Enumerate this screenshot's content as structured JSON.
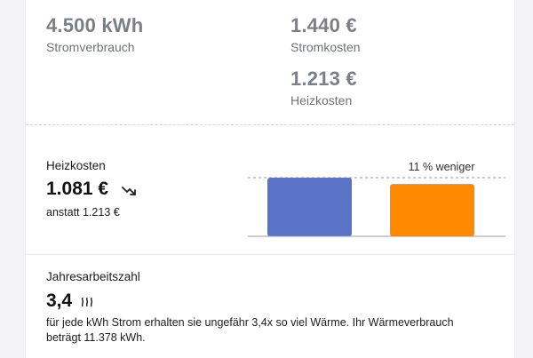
{
  "summary": {
    "power_usage_value": "4.500 kWh",
    "power_usage_label": "Stromverbrauch",
    "power_cost_value": "1.440 €",
    "power_cost_label": "Stromkosten",
    "heating_cost_value": "1.213 €",
    "heating_cost_label": "Heizkosten"
  },
  "heating": {
    "title": "Heizkosten",
    "value": "1.081 €",
    "trend_icon": "trend-down-icon",
    "comparison": "anstatt 1.213 €"
  },
  "chart_data": {
    "type": "bar",
    "categories": [
      "",
      ""
    ],
    "values": [
      1213,
      1081
    ],
    "colors": [
      "#5b73c7",
      "#ff8a00"
    ],
    "annotation": "11 % weniger",
    "ylim": [
      0,
      1213
    ]
  },
  "cop": {
    "title": "Jahresarbeitszahl",
    "value": "3,4",
    "icon": "heat-waves-icon",
    "description": "für jede kWh Strom erhalten sie ungefähr 3,4x so viel Wärme. Ihr Wärmeverbrauch beträgt 11.378 kWh."
  }
}
